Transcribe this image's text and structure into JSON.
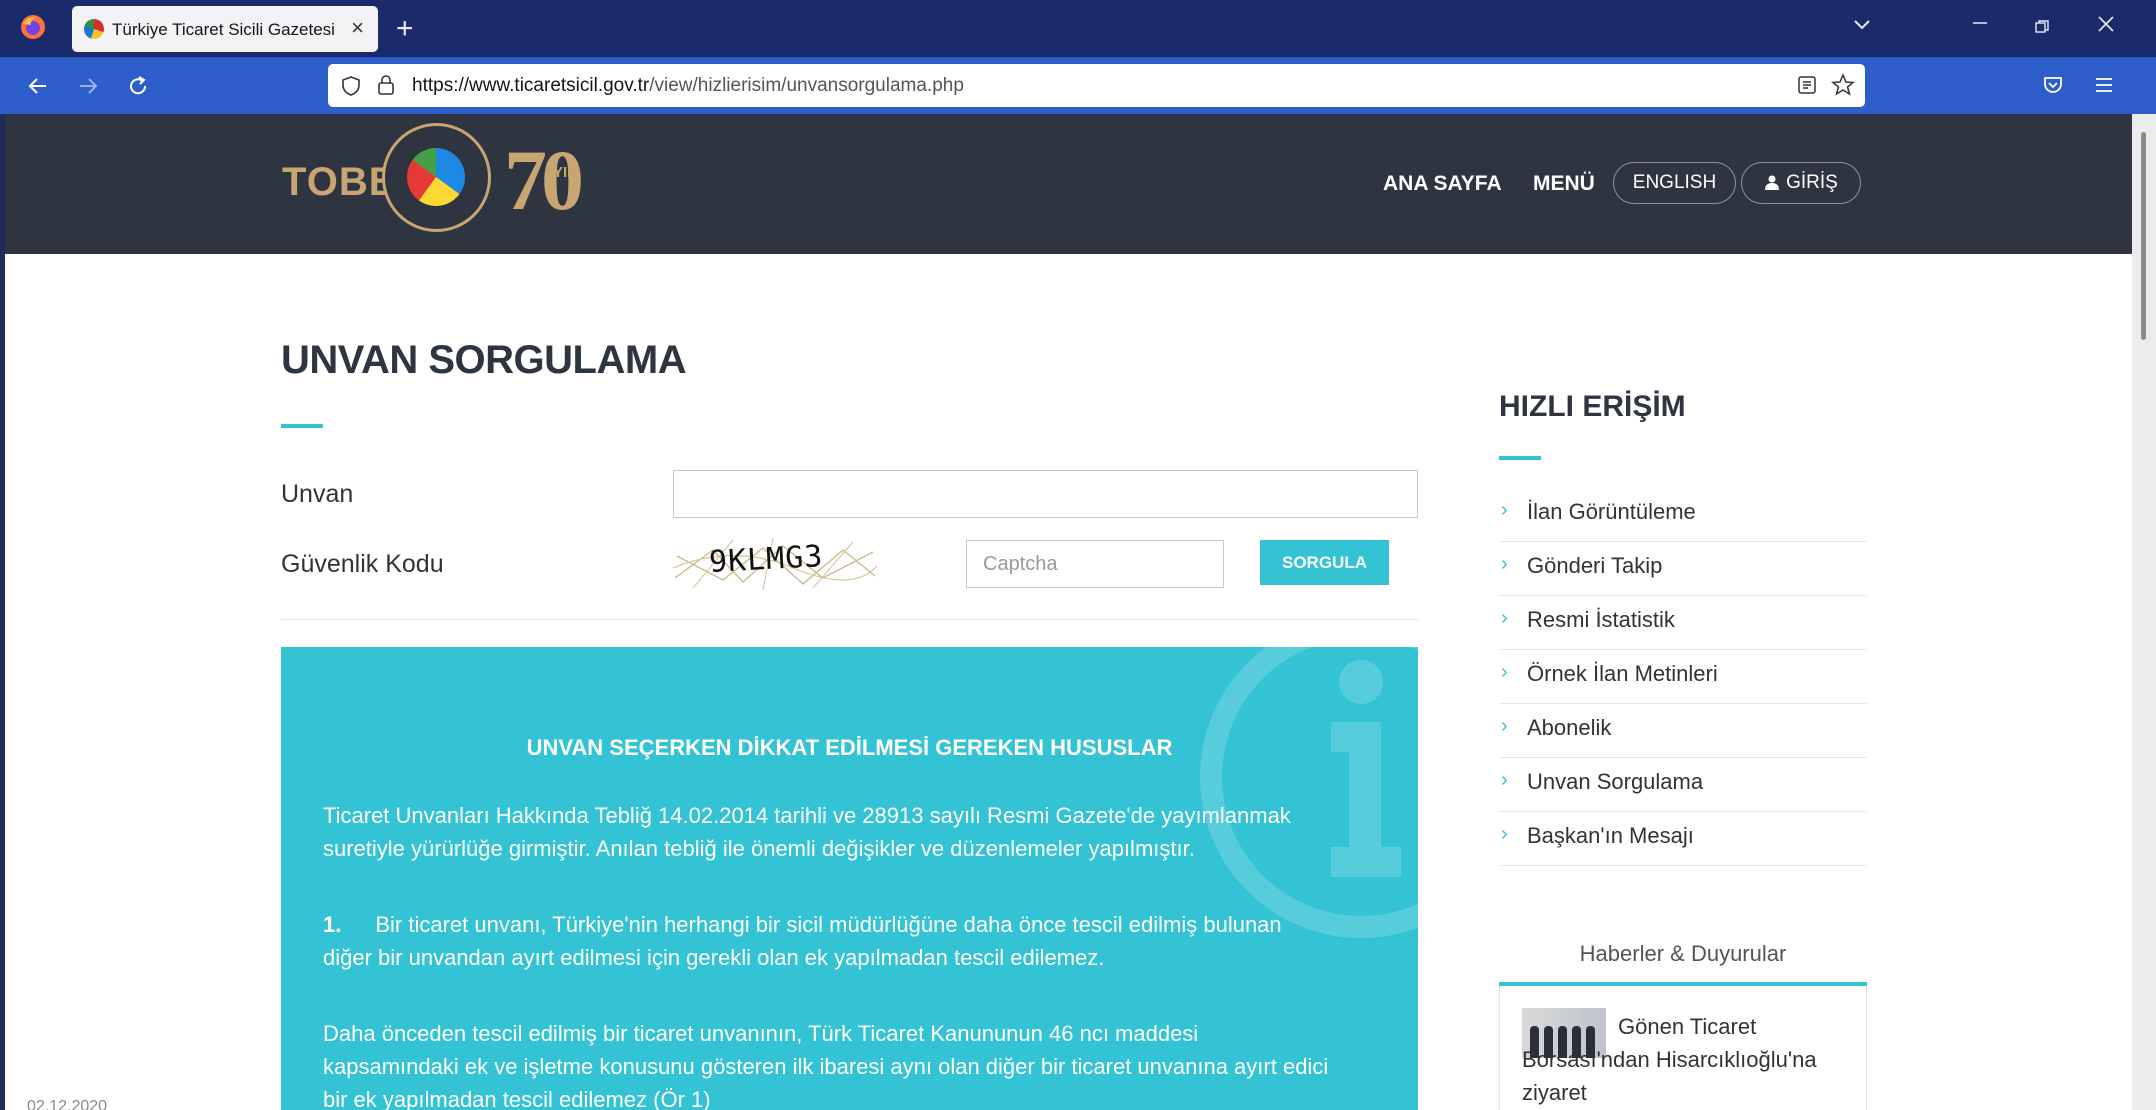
{
  "browser": {
    "tab_title": "Türkiye Ticaret Sicili Gazetesi | Ticaret Sicili",
    "url_host": "https://www.ticaretsicil.gov.tr",
    "url_path": "/view/hizlierisim/unvansorgulama.php"
  },
  "header": {
    "logo_text": "TOBB",
    "logo_anniversary": "70",
    "logo_anniversary_suffix": "YIL",
    "nav": {
      "home": "ANA SAYFA",
      "menu": "MENÜ",
      "english": "ENGLISH",
      "login": "GİRİŞ"
    }
  },
  "main": {
    "title": "UNVAN SORGULAMA",
    "form": {
      "unvan_label": "Unvan",
      "unvan_value": "",
      "security_label": "Güvenlik Kodu",
      "captcha_code": "9KLMG3",
      "captcha_placeholder": "Captcha",
      "submit_label": "SORGULA"
    },
    "info": {
      "title": "UNVAN SEÇERKEN DİKKAT EDİLMESİ GEREKEN HUSUSLAR",
      "p1": "Ticaret Unvanları Hakkında Tebliğ 14.02.2014 tarihli ve 28913 sayılı Resmi Gazete'de yayımlanmak suretiyle yürürlüğe girmiştir. Anılan tebliğ ile önemli değişikler ve düzenlemeler yapılmıştır.",
      "item1_num": "1.",
      "item1_text": "Bir ticaret unvanı, Türkiye'nin herhangi bir sicil müdürlüğüne daha önce tescil edilmiş bulunan diğer bir unvandan ayırt edilmesi için gerekli olan ek yapılmadan tescil edilemez.",
      "p2": "Daha önceden tescil edilmiş bir ticaret unvanının, Türk Ticaret Kanununun 46 ncı maddesi kapsamındaki ek ve işletme konusunu gösteren ilk ibaresi aynı olan diğer bir ticaret unvanına ayırt edici bir ek yapılmadan tescil edilemez (Ör 1)"
    }
  },
  "sidebar": {
    "title": "HIZLI ERİŞİM",
    "items": [
      {
        "label": "İlan Görüntüleme"
      },
      {
        "label": "Gönderi Takip"
      },
      {
        "label": "Resmi İstatistik"
      },
      {
        "label": "Örnek İlan Metinleri"
      },
      {
        "label": "Abonelik"
      },
      {
        "label": "Unvan Sorgulama"
      },
      {
        "label": "Başkan'ın Mesajı"
      }
    ],
    "news": {
      "heading": "Haberler & Duyurular",
      "item_title": "Gönen Ticaret Borsası'ndan Hisarcıklıoğlu'na ziyaret",
      "item_date": "02.12.2020"
    }
  },
  "colors": {
    "accent": "#33c3d4",
    "header_bg": "#2e3540",
    "logo_gold": "#c9a572"
  },
  "icons": [
    "firefox-icon",
    "chevron-down-icon",
    "minimize-icon",
    "restore-icon",
    "close-icon",
    "back-icon",
    "forward-icon",
    "reload-icon",
    "shield-icon",
    "lock-icon",
    "reader-icon",
    "star-icon",
    "pocket-icon",
    "hamburger-icon",
    "user-icon",
    "chevron-right-icon",
    "info-icon"
  ]
}
